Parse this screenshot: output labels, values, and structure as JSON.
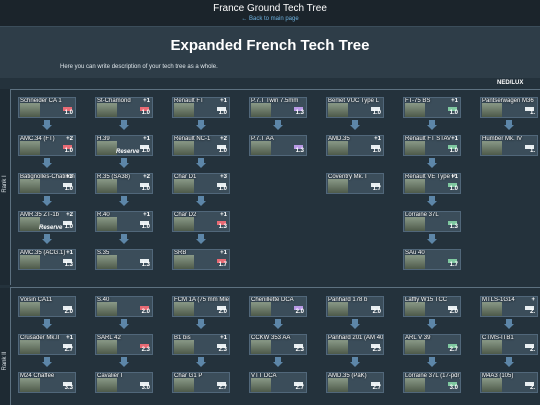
{
  "topbar": {
    "title": "France Ground Tech Tree",
    "back_link": "← Back to main page"
  },
  "header": {
    "title": "Expanded French Tech Tree",
    "description": "Here you can write description of your tech tree as a whole."
  },
  "nation_label": "NED/LUX",
  "ranks": [
    {
      "label": "Rank I"
    },
    {
      "label": "Rank II"
    }
  ],
  "cards": [
    {
      "name": "Schneider CA 1",
      "br": "1.0",
      "plus": "",
      "reserve": ""
    },
    {
      "name": "St-Chamond",
      "br": "1.0",
      "plus": "+1",
      "reserve": ""
    },
    {
      "name": "Renault FT",
      "br": "1.0",
      "plus": "+1",
      "reserve": ""
    },
    {
      "name": "P.7.T Twin 7.5mm",
      "br": "1.3",
      "plus": "",
      "reserve": ""
    },
    {
      "name": "Berliet VUC Type L",
      "br": "1.0",
      "plus": "",
      "reserve": ""
    },
    {
      "name": "FT-75 BS",
      "br": "1.0",
      "plus": "+1",
      "reserve": ""
    },
    {
      "name": "Pantserwagen M36",
      "br": "1.",
      "plus": "",
      "reserve": ""
    },
    {
      "name": "AMC.34 (FT)",
      "br": "1.0",
      "plus": "+2",
      "reserve": ""
    },
    {
      "name": "H.39",
      "br": "1.0",
      "plus": "+1",
      "reserve": "Reserve (1.0)"
    },
    {
      "name": "Renault NC-1",
      "br": "1.0",
      "plus": "+2",
      "reserve": ""
    },
    {
      "name": "P.7.T AA",
      "br": "1.3",
      "plus": "",
      "reserve": ""
    },
    {
      "name": "AMD.35",
      "br": "1.0",
      "plus": "+1",
      "reserve": ""
    },
    {
      "name": "Renault FT STAV",
      "br": "1.0",
      "plus": "+1",
      "reserve": ""
    },
    {
      "name": "Humber Mk. IV",
      "br": "1.",
      "plus": "",
      "reserve": ""
    },
    {
      "name": "Batignolles-Chatillon",
      "br": "1.0",
      "plus": "+3",
      "reserve": ""
    },
    {
      "name": "R.35 (SA38)",
      "br": "1.0",
      "plus": "+2",
      "reserve": ""
    },
    {
      "name": "Char D1",
      "br": "1.0",
      "plus": "+3",
      "reserve": ""
    },
    {
      "name": "Coventry Mk. I",
      "br": "1.7",
      "plus": "",
      "reserve": ""
    },
    {
      "name": "Renault VE Type P",
      "br": "1.0",
      "plus": "+1",
      "reserve": ""
    },
    {
      "name": "AMR.35 ZT-1b",
      "br": "1.0",
      "plus": "+2",
      "reserve": "Reserve (1.0)"
    },
    {
      "name": "R.40",
      "br": "1.0",
      "plus": "+1",
      "reserve": ""
    },
    {
      "name": "Char D2",
      "br": "1.3",
      "plus": "+1",
      "reserve": ""
    },
    {
      "name": "Lorraine 37L",
      "br": "1.3",
      "plus": "",
      "reserve": ""
    },
    {
      "name": "AMC.35 (ACG.1)",
      "br": "1.3",
      "plus": "+1",
      "reserve": ""
    },
    {
      "name": "S.35",
      "br": "1.3",
      "plus": "",
      "reserve": ""
    },
    {
      "name": "SRB",
      "br": "1.7",
      "plus": "+1",
      "reserve": ""
    },
    {
      "name": "SAu 40",
      "br": "1.7",
      "plus": "",
      "reserve": ""
    },
    {
      "name": "Voisin CA11",
      "br": "2.0",
      "plus": "",
      "reserve": ""
    },
    {
      "name": "S.40",
      "br": "2.0",
      "plus": "",
      "reserve": ""
    },
    {
      "name": "FCM 1A (75 mm Mle. 1897)",
      "br": "2.0",
      "plus": "",
      "reserve": ""
    },
    {
      "name": "Chenillette DCA",
      "br": "2.0",
      "plus": "",
      "reserve": ""
    },
    {
      "name": "Panhard 178 b",
      "br": "2.0",
      "plus": "",
      "reserve": ""
    },
    {
      "name": "Laffly W15 TCC",
      "br": "2.0",
      "plus": "",
      "reserve": ""
    },
    {
      "name": "MTLS-1G14",
      "br": "2.",
      "plus": "+",
      "reserve": ""
    },
    {
      "name": "Crusader Mk.II",
      "br": "2.7",
      "plus": "+1",
      "reserve": ""
    },
    {
      "name": "SARL 42",
      "br": "2.3",
      "plus": "",
      "reserve": ""
    },
    {
      "name": "B1 bis",
      "br": "2.3",
      "plus": "+1",
      "reserve": ""
    },
    {
      "name": "CCKW 353 AA",
      "br": "2.3",
      "plus": "",
      "reserve": ""
    },
    {
      "name": "Panhard 201 (AM 40P)",
      "br": "2.3",
      "plus": "",
      "reserve": ""
    },
    {
      "name": "ARL V 39",
      "br": "2.7",
      "plus": "",
      "reserve": ""
    },
    {
      "name": "CTMS-ITB1",
      "br": "2.",
      "plus": "",
      "reserve": ""
    },
    {
      "name": "M24 Chaffee",
      "br": "3.3",
      "plus": "",
      "reserve": ""
    },
    {
      "name": "Cavalier I",
      "br": "3.0",
      "plus": "",
      "reserve": ""
    },
    {
      "name": "Char G1 P",
      "br": "2.7",
      "plus": "",
      "reserve": ""
    },
    {
      "name": "VTT DCA",
      "br": "2.7",
      "plus": "",
      "reserve": ""
    },
    {
      "name": "AMD.35 (PaK)",
      "br": "2.7",
      "plus": "",
      "reserve": ""
    },
    {
      "name": "Lorraine 37L (17-pdr)",
      "br": "3.0",
      "plus": "",
      "reserve": ""
    },
    {
      "name": "M4A3 (105)",
      "br": "2.",
      "plus": "",
      "reserve": ""
    }
  ]
}
